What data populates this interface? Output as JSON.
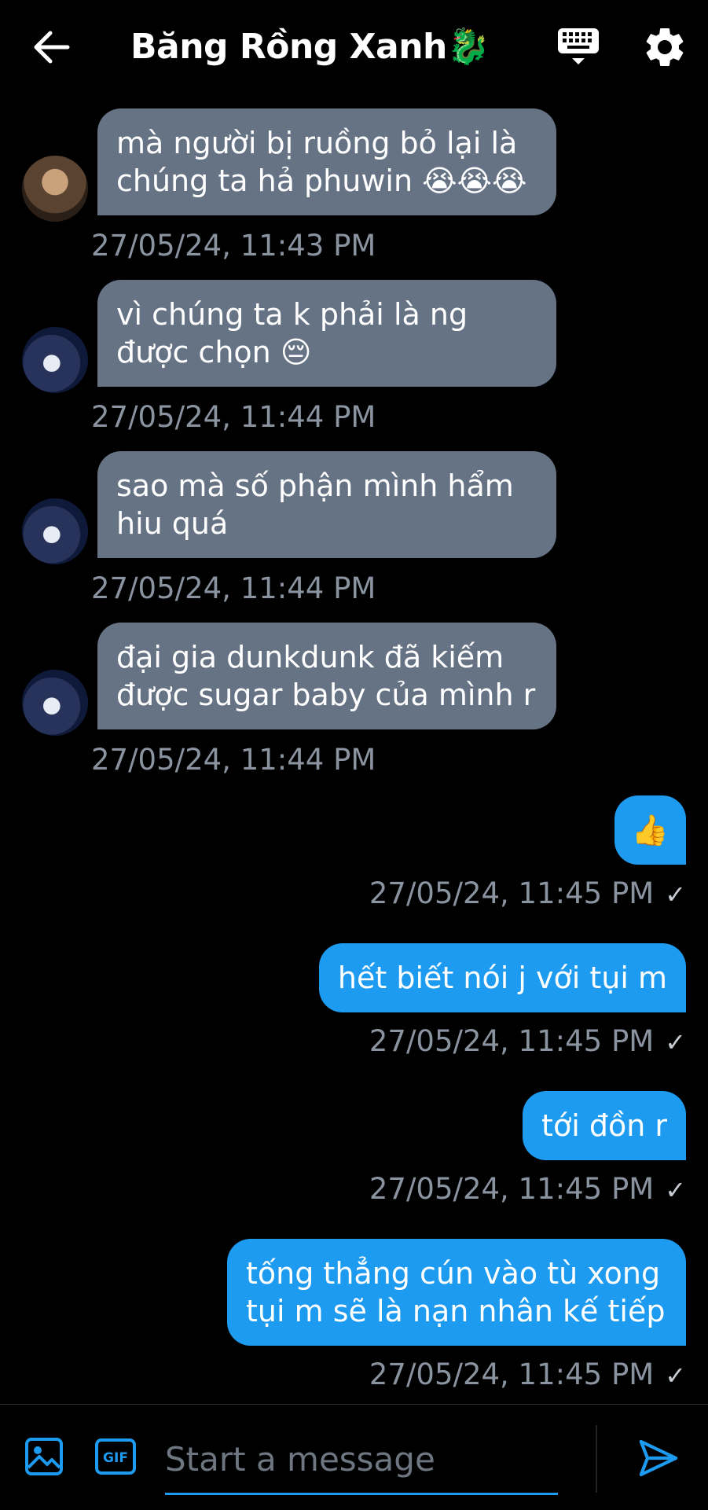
{
  "header": {
    "back_icon": "arrow-left-icon",
    "title": "Băng Rồng Xanh🐉",
    "keyboard_icon": "keyboard-icon",
    "settings_icon": "gear-icon"
  },
  "messages_in": [
    {
      "text": "mà người bị ruồng bỏ lại là chúng ta hả phuwin 😭😭😭",
      "time": "27/05/24, 11:43 PM"
    },
    {
      "text": "vì chúng ta k phải là ng được chọn 😔",
      "time": "27/05/24, 11:44 PM"
    },
    {
      "text": "sao mà số phận mình hẩm hiu quá",
      "time": "27/05/24, 11:44 PM"
    },
    {
      "text": "đại gia dunkdunk đã kiếm được sugar baby của mình r",
      "time": "27/05/24, 11:44 PM"
    }
  ],
  "messages_out": [
    {
      "text": "👍",
      "time": "27/05/24, 11:45 PM",
      "check": "✓"
    },
    {
      "text": "hết biết nói j với tụi m",
      "time": "27/05/24, 11:45 PM",
      "check": "✓"
    },
    {
      "text": "tới đồn r",
      "time": "27/05/24, 11:45 PM",
      "check": "✓"
    },
    {
      "text": "tống thẳng cún vào tù xong tụi m sẽ là nạn nhân kế tiếp",
      "time": "27/05/24, 11:45 PM",
      "check": "✓"
    }
  ],
  "composer": {
    "image_icon": "image-icon",
    "gif_label": "GIF",
    "placeholder": "Start a message",
    "send_icon": "send-icon"
  },
  "colors": {
    "incoming_bubble": "#667385",
    "outgoing_bubble": "#1d9bf0",
    "background": "#000000",
    "timestamp": "#8a93a0"
  }
}
